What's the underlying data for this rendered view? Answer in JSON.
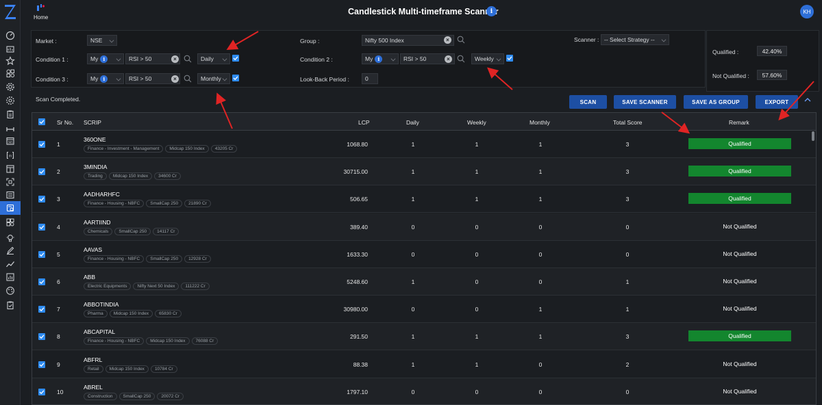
{
  "header": {
    "home_label": "Home",
    "title": "Candlestick Multi-timeframe Scanner",
    "info_glyph": "i",
    "avatar_initials": "KH"
  },
  "filters": {
    "market_label": "Market :",
    "market_value": "NSE",
    "group_label": "Group :",
    "group_value": "Nifty 500 Index",
    "scanner_label": "Scanner :",
    "scanner_value": "-- Select Strategy --",
    "condition1": {
      "label": "Condition 1 :",
      "source": "My",
      "expr": "RSI > 50",
      "timeframe": "Daily",
      "enabled": true
    },
    "condition2": {
      "label": "Condition 2 :",
      "source": "My",
      "expr": "RSI > 50",
      "timeframe": "Weekly",
      "enabled": true
    },
    "condition3": {
      "label": "Condition 3 :",
      "source": "My",
      "expr": "RSI > 50",
      "timeframe": "Monthly",
      "enabled": true
    },
    "lookback_label": "Look-Back Period :",
    "lookback_value": "0"
  },
  "stats": {
    "qualified_label": "Qualified :",
    "qualified_value": "42.40%",
    "not_qualified_label": "Not Qualified :",
    "not_qualified_value": "57.60%"
  },
  "toolbar": {
    "status": "Scan Completed.",
    "scan": "SCAN",
    "save_scanner": "SAVE SCANNER",
    "save_as_group": "SAVE AS GROUP",
    "export": "EXPORT"
  },
  "table": {
    "columns": {
      "sr": "Sr No.",
      "scrip": "SCRIP",
      "lcp": "LCP",
      "daily": "Daily",
      "weekly": "Weekly",
      "monthly": "Monthly",
      "total": "Total Score",
      "remark": "Remark"
    },
    "rows": [
      {
        "sr": "1",
        "scrip": "360ONE",
        "tags": [
          "Finance - Investment - Management",
          "Midcap 150 Index",
          "43205 Cr"
        ],
        "lcp": "1068.80",
        "daily": "1",
        "weekly": "1",
        "monthly": "1",
        "total": "3",
        "remark": "Qualified",
        "qualified": true
      },
      {
        "sr": "2",
        "scrip": "3MINDIA",
        "tags": [
          "Trading",
          "Midcap 150 Index",
          "34600 Cr"
        ],
        "lcp": "30715.00",
        "daily": "1",
        "weekly": "1",
        "monthly": "1",
        "total": "3",
        "remark": "Qualified",
        "qualified": true
      },
      {
        "sr": "3",
        "scrip": "AADHARHFC",
        "tags": [
          "Finance - Housing - NBFC",
          "SmallCap 250",
          "21890 Cr"
        ],
        "lcp": "506.65",
        "daily": "1",
        "weekly": "1",
        "monthly": "1",
        "total": "3",
        "remark": "Qualified",
        "qualified": true
      },
      {
        "sr": "4",
        "scrip": "AARTIIND",
        "tags": [
          "Chemicals",
          "SmallCap 250",
          "14117 Cr"
        ],
        "lcp": "389.40",
        "daily": "0",
        "weekly": "0",
        "monthly": "0",
        "total": "0",
        "remark": "Not Qualified",
        "qualified": false
      },
      {
        "sr": "5",
        "scrip": "AAVAS",
        "tags": [
          "Finance - Housing - NBFC",
          "SmallCap 250",
          "12928 Cr"
        ],
        "lcp": "1633.30",
        "daily": "0",
        "weekly": "0",
        "monthly": "0",
        "total": "0",
        "remark": "Not Qualified",
        "qualified": false
      },
      {
        "sr": "6",
        "scrip": "ABB",
        "tags": [
          "Electric Equipments",
          "Nifty Next 50 Index",
          "111222 Cr"
        ],
        "lcp": "5248.60",
        "daily": "1",
        "weekly": "0",
        "monthly": "0",
        "total": "1",
        "remark": "Not Qualified",
        "qualified": false
      },
      {
        "sr": "7",
        "scrip": "ABBOTINDIA",
        "tags": [
          "Pharma",
          "Midcap 150 Index",
          "65830 Cr"
        ],
        "lcp": "30980.00",
        "daily": "0",
        "weekly": "0",
        "monthly": "1",
        "total": "1",
        "remark": "Not Qualified",
        "qualified": false
      },
      {
        "sr": "8",
        "scrip": "ABCAPITAL",
        "tags": [
          "Finance - Housing - NBFC",
          "Midcap 150 Index",
          "76088 Cr"
        ],
        "lcp": "291.50",
        "daily": "1",
        "weekly": "1",
        "monthly": "1",
        "total": "3",
        "remark": "Qualified",
        "qualified": true
      },
      {
        "sr": "9",
        "scrip": "ABFRL",
        "tags": [
          "Retail",
          "Midcap 150 Index",
          "10784 Cr"
        ],
        "lcp": "88.38",
        "daily": "1",
        "weekly": "1",
        "monthly": "0",
        "total": "2",
        "remark": "Not Qualified",
        "qualified": false
      },
      {
        "sr": "10",
        "scrip": "ABREL",
        "tags": [
          "Construction",
          "SmallCap 250",
          "20072 Cr"
        ],
        "lcp": "1797.10",
        "daily": "0",
        "weekly": "0",
        "monthly": "0",
        "total": "0",
        "remark": "Not Qualified",
        "qualified": false
      }
    ]
  },
  "colors": {
    "accent": "#2e6fd8",
    "button": "#1d4fa3",
    "qualified": "#13862e",
    "annotation_arrow": "#e02424"
  },
  "sidebar_icons": [
    "dashboard-icon",
    "chart-icon",
    "star-icon",
    "shapes-icon",
    "settings-icon",
    "gear-icon",
    "clipboard-icon",
    "range-icon",
    "calendar-icon",
    "bracket-icon",
    "window-icon",
    "scan-icon",
    "list-icon",
    "scanner-icon",
    "grid-icon",
    "bulb-icon",
    "pen-icon",
    "trend-icon",
    "report-icon",
    "palette-icon",
    "clipboard-check-icon"
  ]
}
